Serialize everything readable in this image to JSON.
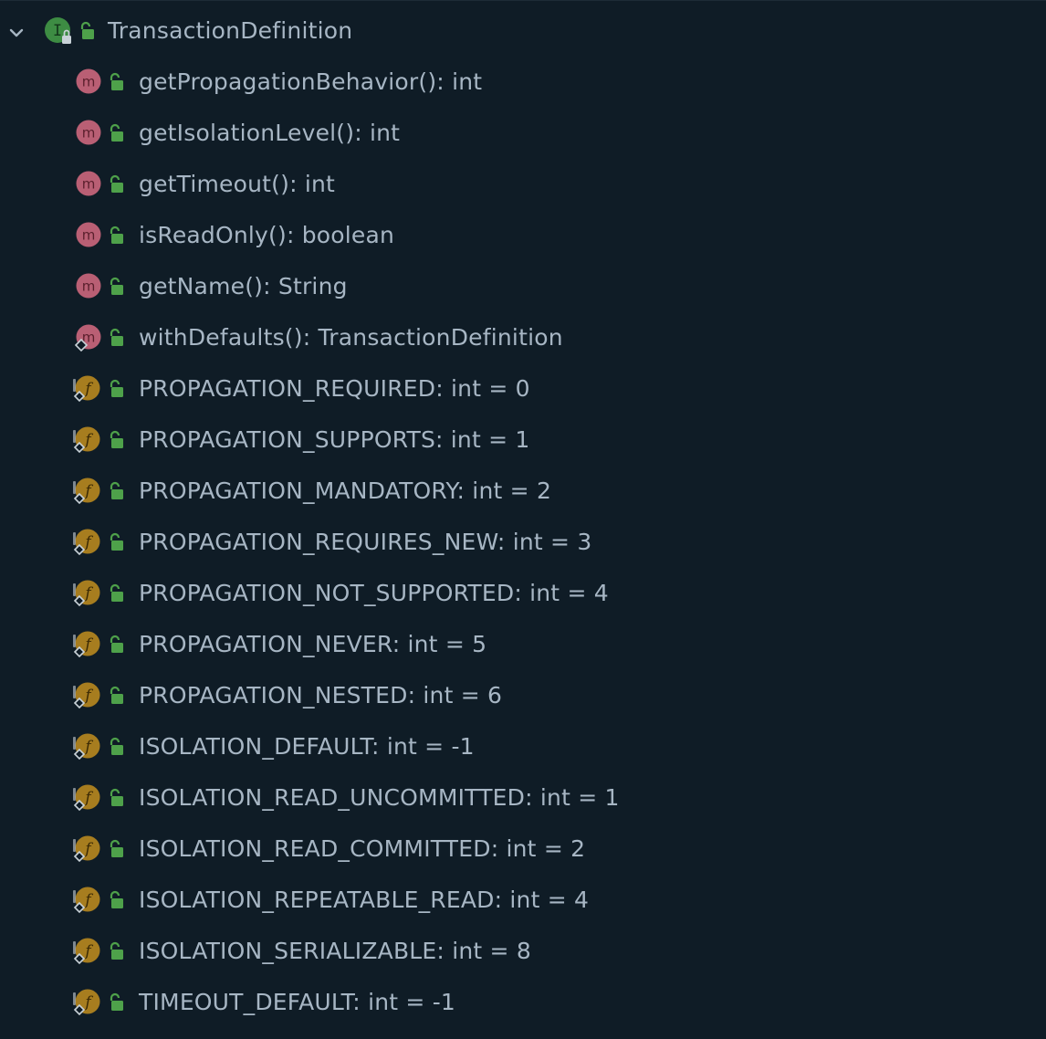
{
  "tree": {
    "root": {
      "label": "TransactionDefinition",
      "icon": "interface-icon",
      "expanded": true
    },
    "methods": [
      {
        "label": "getPropagationBehavior(): int",
        "icon": "method-icon"
      },
      {
        "label": "getIsolationLevel(): int",
        "icon": "method-icon"
      },
      {
        "label": "getTimeout(): int",
        "icon": "method-icon"
      },
      {
        "label": "isReadOnly(): boolean",
        "icon": "method-icon"
      },
      {
        "label": "getName(): String",
        "icon": "method-icon"
      },
      {
        "label": "withDefaults(): TransactionDefinition",
        "icon": "static-method-icon"
      }
    ],
    "constants": [
      {
        "label": "PROPAGATION_REQUIRED: int = 0",
        "icon": "constant-field-icon"
      },
      {
        "label": "PROPAGATION_SUPPORTS: int = 1",
        "icon": "constant-field-icon"
      },
      {
        "label": "PROPAGATION_MANDATORY: int = 2",
        "icon": "constant-field-icon"
      },
      {
        "label": "PROPAGATION_REQUIRES_NEW: int = 3",
        "icon": "constant-field-icon"
      },
      {
        "label": "PROPAGATION_NOT_SUPPORTED: int = 4",
        "icon": "constant-field-icon"
      },
      {
        "label": "PROPAGATION_NEVER: int = 5",
        "icon": "constant-field-icon"
      },
      {
        "label": "PROPAGATION_NESTED: int = 6",
        "icon": "constant-field-icon"
      },
      {
        "label": "ISOLATION_DEFAULT: int = -1",
        "icon": "constant-field-icon"
      },
      {
        "label": "ISOLATION_READ_UNCOMMITTED: int = 1",
        "icon": "constant-field-icon"
      },
      {
        "label": "ISOLATION_READ_COMMITTED: int = 2",
        "icon": "constant-field-icon"
      },
      {
        "label": "ISOLATION_REPEATABLE_READ: int = 4",
        "icon": "constant-field-icon"
      },
      {
        "label": "ISOLATION_SERIALIZABLE: int = 8",
        "icon": "constant-field-icon"
      },
      {
        "label": "TIMEOUT_DEFAULT: int = -1",
        "icon": "constant-field-icon"
      }
    ]
  },
  "colors": {
    "background": "#0f1c26",
    "text": "#a7b6c4",
    "interface_badge": "#3d8c43",
    "method_badge": "#b95f74",
    "field_badge": "#a77d1f",
    "lock_green": "#4ea14a"
  }
}
